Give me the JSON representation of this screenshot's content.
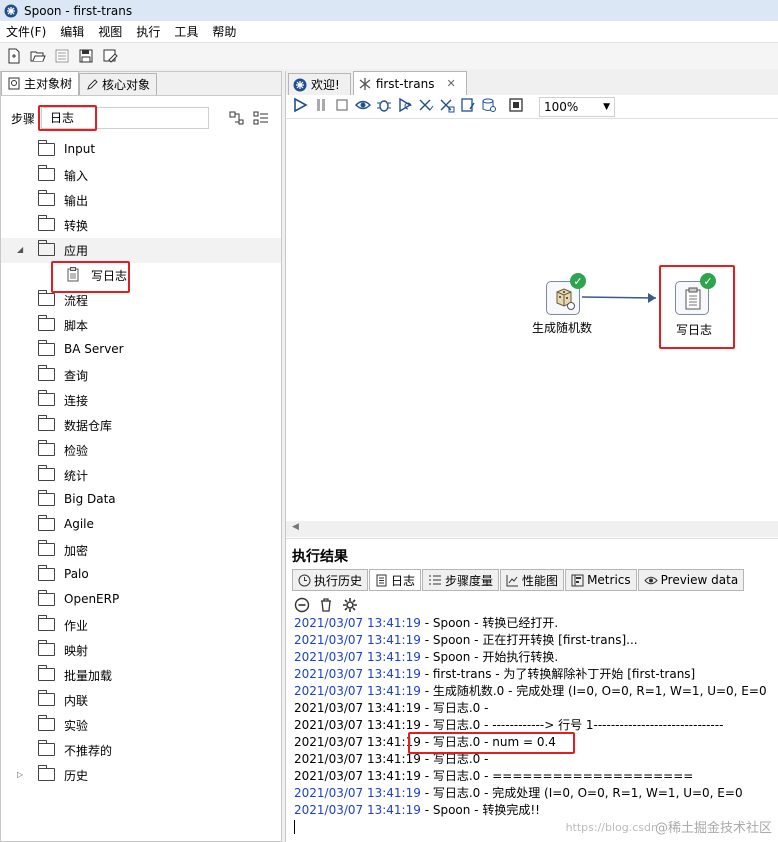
{
  "window": {
    "title": "Spoon - first-trans"
  },
  "menu": [
    "文件(F)",
    "编辑",
    "视图",
    "执行",
    "工具",
    "帮助"
  ],
  "left_panel": {
    "tabs": [
      "主对象树",
      "核心对象"
    ],
    "search_label": "步骤",
    "search_value": "日志",
    "tree": [
      "Input",
      "输入",
      "输出",
      "转换",
      "应用",
      "写日志",
      "流程",
      "脚本",
      "BA Server",
      "查询",
      "连接",
      "数据仓库",
      "检验",
      "统计",
      "Big Data",
      "Agile",
      "加密",
      "Palo",
      "OpenERP",
      "作业",
      "映射",
      "批量加载",
      "内联",
      "实验",
      "不推荐的",
      "历史"
    ]
  },
  "editor": {
    "tabs": [
      "欢迎!",
      "first-trans"
    ],
    "zoom": "100%",
    "steps": [
      {
        "label": "生成随机数"
      },
      {
        "label": "写日志"
      }
    ]
  },
  "results": {
    "title": "执行结果",
    "tabs": [
      "执行历史",
      "日志",
      "步骤度量",
      "性能图",
      "Metrics",
      "Preview data"
    ],
    "log": [
      {
        "ts": "2021/03/07 13:41:19",
        "msg": " - Spoon - 转换已经打开.",
        "style": "blue"
      },
      {
        "ts": "2021/03/07 13:41:19",
        "msg": " - Spoon - 正在打开转换 [first-trans]...",
        "style": "blue"
      },
      {
        "ts": "2021/03/07 13:41:19",
        "msg": " - Spoon - 开始执行转换.",
        "style": "blue"
      },
      {
        "ts": "2021/03/07 13:41:19",
        "msg": " - first-trans - 为了转换解除补丁开始  [first-trans]",
        "style": "blue"
      },
      {
        "ts": "2021/03/07 13:41:19",
        "msg": " - 生成随机数.0 - 完成处理 (I=0, O=0, R=1, W=1, U=0, E=0",
        "style": "blue"
      },
      {
        "ts": "2021/03/07 13:41:19",
        "msg": " - 写日志.0 -",
        "style": "black"
      },
      {
        "ts": "2021/03/07 13:41:19",
        "msg": " - 写日志.0 - ------------> 行号 1------------------------------",
        "style": "black"
      },
      {
        "ts": "2021/03/07 13:41:19",
        "msg": " - 写日志.0 - num = 0.4",
        "style": "black"
      },
      {
        "ts": "2021/03/07 13:41:19",
        "msg": " - 写日志.0 -",
        "style": "black"
      },
      {
        "ts": "2021/03/07 13:41:19",
        "msg": " - 写日志.0 - ====================",
        "style": "black"
      },
      {
        "ts": "2021/03/07 13:41:19",
        "msg": " - 写日志.0 - 完成处理 (I=0, O=0, R=1, W=1, U=0, E=0",
        "style": "blue"
      },
      {
        "ts": "2021/03/07 13:41:19",
        "msg": " - Spoon - 转换完成!!",
        "style": "blue"
      }
    ]
  },
  "watermark": "@稀土掘金技术社区",
  "watermark_url": "https://blog.csdn"
}
